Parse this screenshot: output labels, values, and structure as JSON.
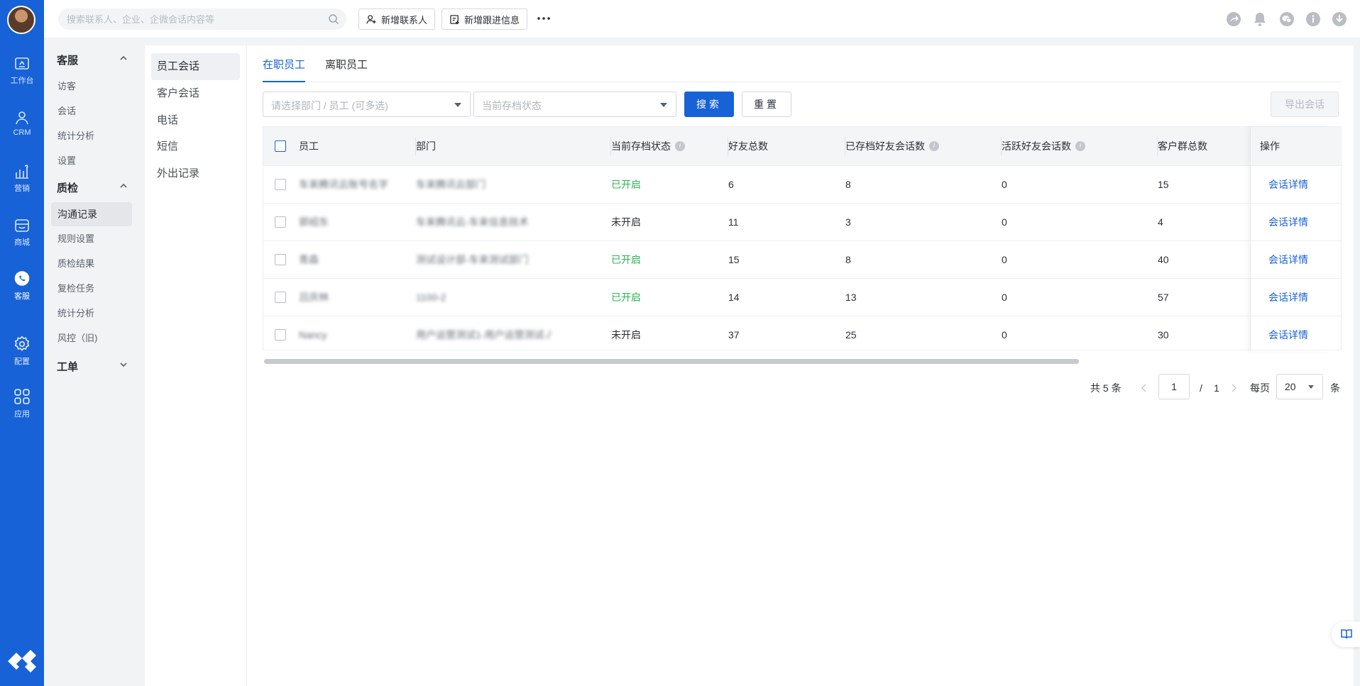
{
  "rail": {
    "items": [
      {
        "label": "工作台",
        "icon": "dashboard-icon"
      },
      {
        "label": "CRM",
        "icon": "person-icon"
      },
      {
        "label": "营销",
        "icon": "bar-chart-icon"
      },
      {
        "label": "商城",
        "icon": "shop-icon"
      },
      {
        "label": "客服",
        "icon": "chat-icon"
      },
      {
        "label": "配置",
        "icon": "gear-icon"
      },
      {
        "label": "应用",
        "icon": "grid-icon"
      }
    ],
    "active": "客服"
  },
  "topbar": {
    "search_placeholder": "搜索联系人、企业、企微会话内容等",
    "add_contact": "新增联系人",
    "add_followup": "新增跟进信息",
    "more": "···"
  },
  "nav2": {
    "group_kefu": "客服",
    "kefu_items": [
      "访客",
      "会话",
      "统计分析",
      "设置"
    ],
    "group_zhijian": "质检",
    "zhijian_items": [
      "沟通记录",
      "规则设置",
      "质检结果",
      "复检任务",
      "统计分析",
      "风控（旧)"
    ],
    "group_gongdan": "工单",
    "active": "沟通记录"
  },
  "nav3": {
    "items": [
      "员工会话",
      "客户会话",
      "电话",
      "短信",
      "外出记录"
    ],
    "active": "员工会话"
  },
  "tabs": [
    "在职员工",
    "离职员工"
  ],
  "filters": {
    "dept_placeholder": "请选择部门 / 员工 (可多选)",
    "status_placeholder": "当前存档状态",
    "search_btn": "搜索",
    "reset_btn": "重置",
    "export_btn": "导出会话"
  },
  "table": {
    "headers": [
      "员工",
      "部门",
      "当前存档状态",
      "好友总数",
      "已存档好友会话数",
      "活跃好友会话数",
      "客户群总数",
      "操作"
    ],
    "rows": [
      {
        "employee": "车来腾讯云账号名字",
        "dept": "车来腾讯云部门",
        "status": "已开启",
        "friends": "6",
        "archived": "8",
        "active": "0",
        "groups": "15",
        "action": "会话详情"
      },
      {
        "employee": "郭绍东",
        "dept": "车来腾讯云-车来信息技术",
        "status": "未开启",
        "friends": "11",
        "archived": "3",
        "active": "0",
        "groups": "4",
        "action": "会话详情"
      },
      {
        "employee": "青森",
        "dept": "测试设计部-车来测试部门",
        "status": "已开启",
        "friends": "15",
        "archived": "8",
        "active": "0",
        "groups": "40",
        "action": "会话详情"
      },
      {
        "employee": "吕庆林",
        "dept": "1100-2",
        "status": "已开启",
        "friends": "14",
        "archived": "13",
        "active": "0",
        "groups": "57",
        "action": "会话详情"
      },
      {
        "employee": "Nancy",
        "dept": "用户运营测试1-用户运营测试-产",
        "status": "未开启",
        "friends": "37",
        "archived": "25",
        "active": "0",
        "groups": "30",
        "action": "会话详情"
      }
    ]
  },
  "pagination": {
    "total": "共 5 条",
    "page": "1",
    "slash": "/",
    "pages": "1",
    "per_page_label": "每页",
    "per_page": "20",
    "unit": "条"
  },
  "colors": {
    "brand": "#1762d6",
    "on": "#2db555"
  }
}
